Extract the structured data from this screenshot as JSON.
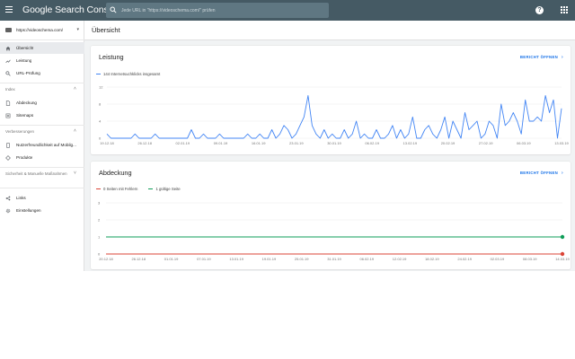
{
  "app": {
    "title": "Google Search Console"
  },
  "search": {
    "placeholder": "Jede URL in \"https://videoschema.com/\" prüfen"
  },
  "sidebar": {
    "property": "https://videoschema.com/",
    "items_top": [
      {
        "label": "Übersicht",
        "icon": "home-icon",
        "active": true
      },
      {
        "label": "Leistung",
        "icon": "trending-icon"
      },
      {
        "label": "URL-Prüfung",
        "icon": "search-icon"
      }
    ],
    "sections": [
      {
        "title": "Index",
        "items": [
          {
            "label": "Abdeckung",
            "icon": "document-icon"
          },
          {
            "label": "Sitemaps",
            "icon": "sitemap-icon"
          }
        ]
      },
      {
        "title": "Verbesserungen",
        "items": [
          {
            "label": "Nutzerfreundlichkeit auf Mobilg...",
            "icon": "mobile-icon"
          },
          {
            "label": "Produkte",
            "icon": "diamond-icon"
          }
        ]
      },
      {
        "title": "Sicherheit & Manuelle Maßnahmen",
        "items": []
      }
    ],
    "items_bottom": [
      {
        "label": "Links",
        "icon": "links-icon"
      },
      {
        "label": "Einstellungen",
        "icon": "settings-icon"
      }
    ]
  },
  "main": {
    "page_title": "Übersicht",
    "open_report_label": "BERICHT ÖFFNEN"
  },
  "chart_data": [
    {
      "type": "line",
      "title": "Leistung",
      "series": [
        {
          "name": "144 Internetsuchklicks insgesamt",
          "color": "#4285f4",
          "values": [
            1,
            0,
            0,
            0,
            0,
            0,
            0,
            1,
            0,
            0,
            0,
            0,
            1,
            0,
            0,
            0,
            0,
            0,
            0,
            0,
            0,
            2,
            0,
            0,
            1,
            0,
            0,
            0,
            1,
            0,
            0,
            0,
            0,
            0,
            0,
            1,
            0,
            0,
            1,
            0,
            0,
            2,
            0,
            1,
            3,
            2,
            0,
            1,
            3,
            5,
            10,
            3,
            1,
            0,
            2,
            0,
            1,
            0,
            0,
            2,
            0,
            1,
            4,
            0,
            1,
            0,
            0,
            2,
            0,
            0,
            1,
            3,
            0,
            2,
            0,
            1,
            5,
            0,
            0,
            2,
            3,
            1,
            0,
            2,
            5,
            0,
            4,
            2,
            0,
            6,
            2,
            3,
            4,
            0,
            1,
            4,
            3,
            0,
            8,
            3,
            4,
            6,
            4,
            1,
            9,
            4,
            4,
            5,
            4,
            10,
            6,
            9,
            0,
            7
          ]
        }
      ],
      "y_ticks": [
        0,
        4,
        8,
        12
      ],
      "ylim": [
        0,
        12
      ],
      "x_tick_labels": [
        "19.12.18",
        "26.12.18",
        "02.01.19",
        "09.01.19",
        "16.01.19",
        "23.01.19",
        "30.01.19",
        "06.02.19",
        "13.02.19",
        "20.02.19",
        "27.02.19",
        "06.03.19",
        "13.03.19"
      ],
      "grid": true
    },
    {
      "type": "line",
      "title": "Abdeckung",
      "series": [
        {
          "name": "0 Seiten mit Fehlern",
          "color": "#db4437",
          "value": 0
        },
        {
          "name": "1 gültige Seite",
          "color": "#0f9d58",
          "value": 1
        }
      ],
      "y_ticks": [
        0,
        1,
        2,
        3
      ],
      "ylim": [
        0,
        3
      ],
      "x_tick_labels": [
        "20.12.18",
        "26.12.18",
        "01.01.19",
        "07.01.19",
        "13.01.19",
        "19.01.19",
        "25.01.19",
        "31.01.19",
        "06.02.19",
        "12.02.19",
        "18.02.19",
        "24.02.19",
        "02.03.19",
        "08.03.19",
        "14.03.19"
      ],
      "grid": true
    }
  ]
}
